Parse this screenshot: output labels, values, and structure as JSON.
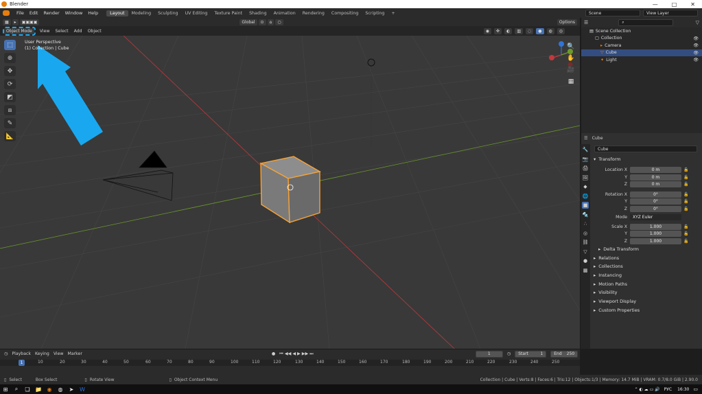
{
  "window": {
    "title": "Blender",
    "controls": [
      "—",
      "□",
      "✕"
    ]
  },
  "menus": [
    "File",
    "Edit",
    "Render",
    "Window",
    "Help"
  ],
  "workspace_tabs": [
    {
      "label": "Layout",
      "active": true
    },
    {
      "label": "Modeling"
    },
    {
      "label": "Sculpting"
    },
    {
      "label": "UV Editing"
    },
    {
      "label": "Texture Paint"
    },
    {
      "label": "Shading"
    },
    {
      "label": "Animation"
    },
    {
      "label": "Rendering"
    },
    {
      "label": "Compositing"
    },
    {
      "label": "Scripting"
    }
  ],
  "scene": {
    "name": "Scene",
    "view_layer": "View Layer"
  },
  "viewport_header": {
    "mode": "Object Mode",
    "menus": [
      "View",
      "Select",
      "Add",
      "Object"
    ],
    "orientation": "Global",
    "options": "Options"
  },
  "overlay_text": {
    "line1": "User Perspective",
    "line2": "(1) Collection | Cube"
  },
  "outliner": {
    "root": "Scene Collection",
    "items": [
      {
        "label": "Collection",
        "indent": 1
      },
      {
        "label": "Camera",
        "indent": 2
      },
      {
        "label": "Cube",
        "indent": 2,
        "selected": true
      },
      {
        "label": "Light",
        "indent": 2
      }
    ]
  },
  "properties": {
    "object_name": "Cube",
    "data_name": "Cube",
    "transform_label": "Transform",
    "location_label": "Location X",
    "rotation_label": "Rotation X",
    "scale_label": "Scale X",
    "axis_y": "Y",
    "axis_z": "Z",
    "location": [
      "0 m",
      "0 m",
      "0 m"
    ],
    "rotation": [
      "0°",
      "0°",
      "0°"
    ],
    "mode_label": "Mode",
    "mode_value": "XYZ Euler",
    "scale": [
      "1.000",
      "1.000",
      "1.000"
    ],
    "delta": "Delta Transform",
    "panels": [
      "Relations",
      "Collections",
      "Instancing",
      "Motion Paths",
      "Visibility",
      "Viewport Display",
      "Custom Properties"
    ]
  },
  "timeline": {
    "menus": [
      "Playback",
      "Keying",
      "View",
      "Marker"
    ],
    "current_frame": "1",
    "start_label": "Start",
    "start": "1",
    "end_label": "End",
    "end": "250",
    "ticks": [
      "1",
      "10",
      "20",
      "30",
      "40",
      "50",
      "60",
      "70",
      "80",
      "90",
      "100",
      "110",
      "120",
      "130",
      "140",
      "150",
      "160",
      "170",
      "180",
      "190",
      "200",
      "210",
      "220",
      "230",
      "240",
      "250"
    ]
  },
  "statusbar": {
    "select": "Select",
    "box_select": "Box Select",
    "rotate_view": "Rotate View",
    "context_menu": "Object Context Menu",
    "stats": "Collection | Cube | Verts:8 | Faces:6 | Tris:12 | Objects:1/3 | Memory: 14.7 MiB | VRAM: 0.7/8.0 GiB | 2.90.0"
  },
  "taskbar": {
    "lang": "РУС",
    "time": "16:30"
  },
  "colors": {
    "accent": "#4772b3",
    "selection": "#f7a336",
    "arrow": "#19a8f0",
    "bg_viewport": "#393939"
  }
}
